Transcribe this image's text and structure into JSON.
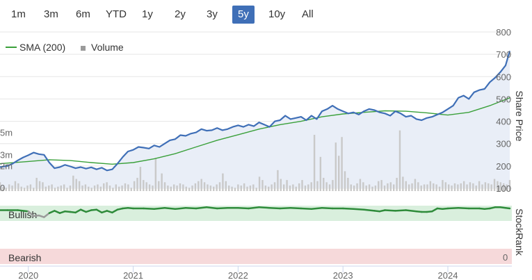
{
  "range_selector": {
    "buttons": [
      "1m",
      "3m",
      "6m",
      "YTD",
      "1y",
      "2y",
      "3y",
      "5y",
      "10y",
      "All"
    ],
    "active": "5y"
  },
  "legend": {
    "sma_label": "SMA (200)",
    "volume_label": "Volume"
  },
  "colors": {
    "price": "#3f6fb7",
    "sma": "#3aa03a",
    "volume": "#c9c9c9",
    "bullish_band": "#d9efdd",
    "bearish_band": "#f6d9da",
    "stockrank_line": "#2e8b3a",
    "stockrank_low": "#9a9a9a",
    "active_button": "#3f6fb7"
  },
  "chart_data": [
    {
      "type": "line",
      "title": "",
      "y_axis_title": "Share Price",
      "x_ticks": [
        "2020",
        "2021",
        "2022",
        "2023",
        "2024"
      ],
      "y_ticks": [
        "100",
        "200",
        "300",
        "400",
        "500",
        "600",
        "700",
        "800"
      ],
      "ylim": [
        100,
        800
      ],
      "volume_ticks": [
        "0",
        "2m",
        "3m",
        "5m"
      ],
      "volume_ylim": [
        0,
        8
      ],
      "xlim": [
        2019.73,
        2024.59
      ],
      "series": [
        {
          "name": "Price",
          "points": [
            [
              2019.73,
              195
            ],
            [
              2019.8,
              200
            ],
            [
              2019.85,
              210
            ],
            [
              2019.9,
              225
            ],
            [
              2019.95,
              238
            ],
            [
              2020.0,
              248
            ],
            [
              2020.05,
              260
            ],
            [
              2020.1,
              253
            ],
            [
              2020.15,
              250
            ],
            [
              2020.2,
              215
            ],
            [
              2020.25,
              190
            ],
            [
              2020.3,
              195
            ],
            [
              2020.35,
              205
            ],
            [
              2020.4,
              198
            ],
            [
              2020.45,
              190
            ],
            [
              2020.5,
              195
            ],
            [
              2020.55,
              188
            ],
            [
              2020.6,
              194
            ],
            [
              2020.65,
              185
            ],
            [
              2020.7,
              192
            ],
            [
              2020.75,
              180
            ],
            [
              2020.8,
              185
            ],
            [
              2020.85,
              210
            ],
            [
              2020.9,
              240
            ],
            [
              2020.95,
              265
            ],
            [
              2021.0,
              272
            ],
            [
              2021.05,
              285
            ],
            [
              2021.1,
              282
            ],
            [
              2021.15,
              278
            ],
            [
              2021.2,
              292
            ],
            [
              2021.25,
              285
            ],
            [
              2021.3,
              300
            ],
            [
              2021.35,
              315
            ],
            [
              2021.4,
              320
            ],
            [
              2021.45,
              338
            ],
            [
              2021.5,
              335
            ],
            [
              2021.55,
              345
            ],
            [
              2021.6,
              350
            ],
            [
              2021.65,
              365
            ],
            [
              2021.7,
              358
            ],
            [
              2021.75,
              360
            ],
            [
              2021.8,
              370
            ],
            [
              2021.85,
              360
            ],
            [
              2021.9,
              365
            ],
            [
              2021.95,
              375
            ],
            [
              2022.0,
              382
            ],
            [
              2022.05,
              375
            ],
            [
              2022.1,
              385
            ],
            [
              2022.15,
              378
            ],
            [
              2022.2,
              395
            ],
            [
              2022.25,
              385
            ],
            [
              2022.3,
              375
            ],
            [
              2022.35,
              400
            ],
            [
              2022.4,
              405
            ],
            [
              2022.45,
              425
            ],
            [
              2022.5,
              410
            ],
            [
              2022.55,
              415
            ],
            [
              2022.6,
              420
            ],
            [
              2022.65,
              405
            ],
            [
              2022.7,
              425
            ],
            [
              2022.75,
              410
            ],
            [
              2022.8,
              445
            ],
            [
              2022.85,
              455
            ],
            [
              2022.9,
              470
            ],
            [
              2022.95,
              455
            ],
            [
              2023.0,
              445
            ],
            [
              2023.05,
              435
            ],
            [
              2023.1,
              440
            ],
            [
              2023.15,
              430
            ],
            [
              2023.2,
              445
            ],
            [
              2023.25,
              455
            ],
            [
              2023.3,
              450
            ],
            [
              2023.35,
              440
            ],
            [
              2023.4,
              435
            ],
            [
              2023.45,
              425
            ],
            [
              2023.5,
              445
            ],
            [
              2023.55,
              435
            ],
            [
              2023.6,
              420
            ],
            [
              2023.65,
              425
            ],
            [
              2023.7,
              410
            ],
            [
              2023.75,
              405
            ],
            [
              2023.8,
              415
            ],
            [
              2023.85,
              420
            ],
            [
              2023.9,
              430
            ],
            [
              2023.95,
              440
            ],
            [
              2024.0,
              455
            ],
            [
              2024.05,
              470
            ],
            [
              2024.1,
              505
            ],
            [
              2024.15,
              515
            ],
            [
              2024.2,
              500
            ],
            [
              2024.25,
              530
            ],
            [
              2024.3,
              540
            ],
            [
              2024.35,
              545
            ],
            [
              2024.4,
              575
            ],
            [
              2024.45,
              595
            ],
            [
              2024.5,
              620
            ],
            [
              2024.55,
              650
            ],
            [
              2024.59,
              715
            ]
          ]
        },
        {
          "name": "SMA (200)",
          "points": [
            [
              2019.73,
              210
            ],
            [
              2020.0,
              220
            ],
            [
              2020.2,
              228
            ],
            [
              2020.4,
              224
            ],
            [
              2020.6,
              215
            ],
            [
              2020.8,
              208
            ],
            [
              2021.0,
              215
            ],
            [
              2021.2,
              232
            ],
            [
              2021.4,
              255
            ],
            [
              2021.6,
              285
            ],
            [
              2021.8,
              315
            ],
            [
              2022.0,
              340
            ],
            [
              2022.2,
              365
            ],
            [
              2022.4,
              385
            ],
            [
              2022.6,
              400
            ],
            [
              2022.8,
              420
            ],
            [
              2023.0,
              433
            ],
            [
              2023.2,
              440
            ],
            [
              2023.4,
              447
            ],
            [
              2023.6,
              445
            ],
            [
              2023.8,
              438
            ],
            [
              2024.0,
              428
            ],
            [
              2024.2,
              440
            ],
            [
              2024.4,
              470
            ],
            [
              2024.59,
              505
            ]
          ]
        },
        {
          "name": "Volume",
          "x_start": 2019.73,
          "x_end": 2024.59,
          "values": [
            0.8,
            0.4,
            0.3,
            0.6,
            0.5,
            0.9,
            0.7,
            0.4,
            0.3,
            0.5,
            0.6,
            0.3,
            1.2,
            0.9,
            0.8,
            0.4,
            0.5,
            0.6,
            0.3,
            0.4,
            0.5,
            0.6,
            0.3,
            0.5,
            1.4,
            1.1,
            0.9,
            0.5,
            0.6,
            0.4,
            0.3,
            0.5,
            0.6,
            0.4,
            0.7,
            0.8,
            0.5,
            0.3,
            0.6,
            0.4,
            0.5,
            0.7,
            0.6,
            0.3,
            0.9,
            1.2,
            2.2,
            1.0,
            0.8,
            0.6,
            0.5,
            3.0,
            0.9,
            1.6,
            0.8,
            0.5,
            0.4,
            0.6,
            0.5,
            0.7,
            0.6,
            0.4,
            0.3,
            0.5,
            0.7,
            0.9,
            1.1,
            0.8,
            0.6,
            0.5,
            0.4,
            0.6,
            0.8,
            1.6,
            0.9,
            0.5,
            0.4,
            0.3,
            0.6,
            0.5,
            0.7,
            0.4,
            0.5,
            0.6,
            0.3,
            1.3,
            1.0,
            0.5,
            0.4,
            0.6,
            0.8,
            1.9,
            1.1,
            0.6,
            1.0,
            0.5,
            0.6,
            0.4,
            0.7,
            1.0,
            0.5,
            0.6,
            0.8,
            5.1,
            0.9,
            3.1,
            1.2,
            0.8,
            0.6,
            1.0,
            4.4,
            3.2,
            4.9,
            1.8,
            1.2,
            0.6,
            0.5,
            0.7,
            1.1,
            0.8,
            0.5,
            0.6,
            0.4,
            0.5,
            0.9,
            1.0,
            0.5,
            0.7,
            0.8,
            0.6,
            1.2,
            5.5,
            1.3,
            0.9,
            0.6,
            0.7,
            1.1,
            0.8,
            0.5,
            0.6,
            0.6,
            0.9,
            0.7,
            0.6,
            0.4,
            1.0,
            0.8,
            0.6,
            0.5,
            0.7,
            0.6,
            0.7,
            0.9,
            0.6,
            0.8,
            0.7,
            0.5,
            0.9,
            0.6,
            0.8,
            0.7,
            0.6,
            1.1,
            0.9,
            0.8,
            0.7,
            0.6,
            1.0
          ]
        }
      ]
    },
    {
      "type": "line",
      "title": "",
      "y_axis_title": "StockRank",
      "ylim": [
        0,
        100
      ],
      "bands": [
        "Bullish",
        "Bearish"
      ],
      "y_ticks": [
        "0"
      ],
      "series": [
        {
          "name": "StockRank",
          "points": [
            [
              2019.73,
              97
            ],
            [
              2019.8,
              97
            ],
            [
              2019.9,
              97
            ],
            [
              2020.0,
              95
            ],
            [
              2020.05,
              87
            ],
            [
              2020.1,
              88
            ],
            [
              2020.15,
              85
            ],
            [
              2020.2,
              92
            ],
            [
              2020.25,
              96
            ],
            [
              2020.3,
              92
            ],
            [
              2020.35,
              95
            ],
            [
              2020.4,
              94
            ],
            [
              2020.45,
              93
            ],
            [
              2020.5,
              98
            ],
            [
              2020.55,
              94
            ],
            [
              2020.6,
              97
            ],
            [
              2020.65,
              98
            ],
            [
              2020.7,
              93
            ],
            [
              2020.75,
              96
            ],
            [
              2020.8,
              93
            ],
            [
              2020.85,
              98
            ],
            [
              2020.9,
              100
            ],
            [
              2020.95,
              101
            ],
            [
              2021.0,
              100
            ],
            [
              2021.1,
              100
            ],
            [
              2021.2,
              99
            ],
            [
              2021.3,
              101
            ],
            [
              2021.4,
              99
            ],
            [
              2021.5,
              101
            ],
            [
              2021.6,
              100
            ],
            [
              2021.7,
              102
            ],
            [
              2021.8,
              100
            ],
            [
              2021.9,
              101
            ],
            [
              2022.0,
              101
            ],
            [
              2022.1,
              100
            ],
            [
              2022.2,
              102
            ],
            [
              2022.3,
              101
            ],
            [
              2022.4,
              100
            ],
            [
              2022.5,
              101
            ],
            [
              2022.6,
              100
            ],
            [
              2022.7,
              99
            ],
            [
              2022.8,
              101
            ],
            [
              2022.9,
              100
            ],
            [
              2023.0,
              100
            ],
            [
              2023.1,
              99
            ],
            [
              2023.2,
              98
            ],
            [
              2023.3,
              96
            ],
            [
              2023.35,
              95
            ],
            [
              2023.4,
              97
            ],
            [
              2023.5,
              96
            ],
            [
              2023.6,
              97
            ],
            [
              2023.7,
              95
            ],
            [
              2023.75,
              94
            ],
            [
              2023.8,
              94
            ],
            [
              2023.85,
              95
            ],
            [
              2023.9,
              100
            ],
            [
              2023.95,
              99
            ],
            [
              2024.0,
              100
            ],
            [
              2024.1,
              101
            ],
            [
              2024.2,
              100
            ],
            [
              2024.3,
              100
            ],
            [
              2024.35,
              99
            ],
            [
              2024.4,
              100
            ],
            [
              2024.45,
              102
            ],
            [
              2024.5,
              102
            ],
            [
              2024.55,
              101
            ],
            [
              2024.59,
              100
            ]
          ]
        }
      ]
    }
  ]
}
